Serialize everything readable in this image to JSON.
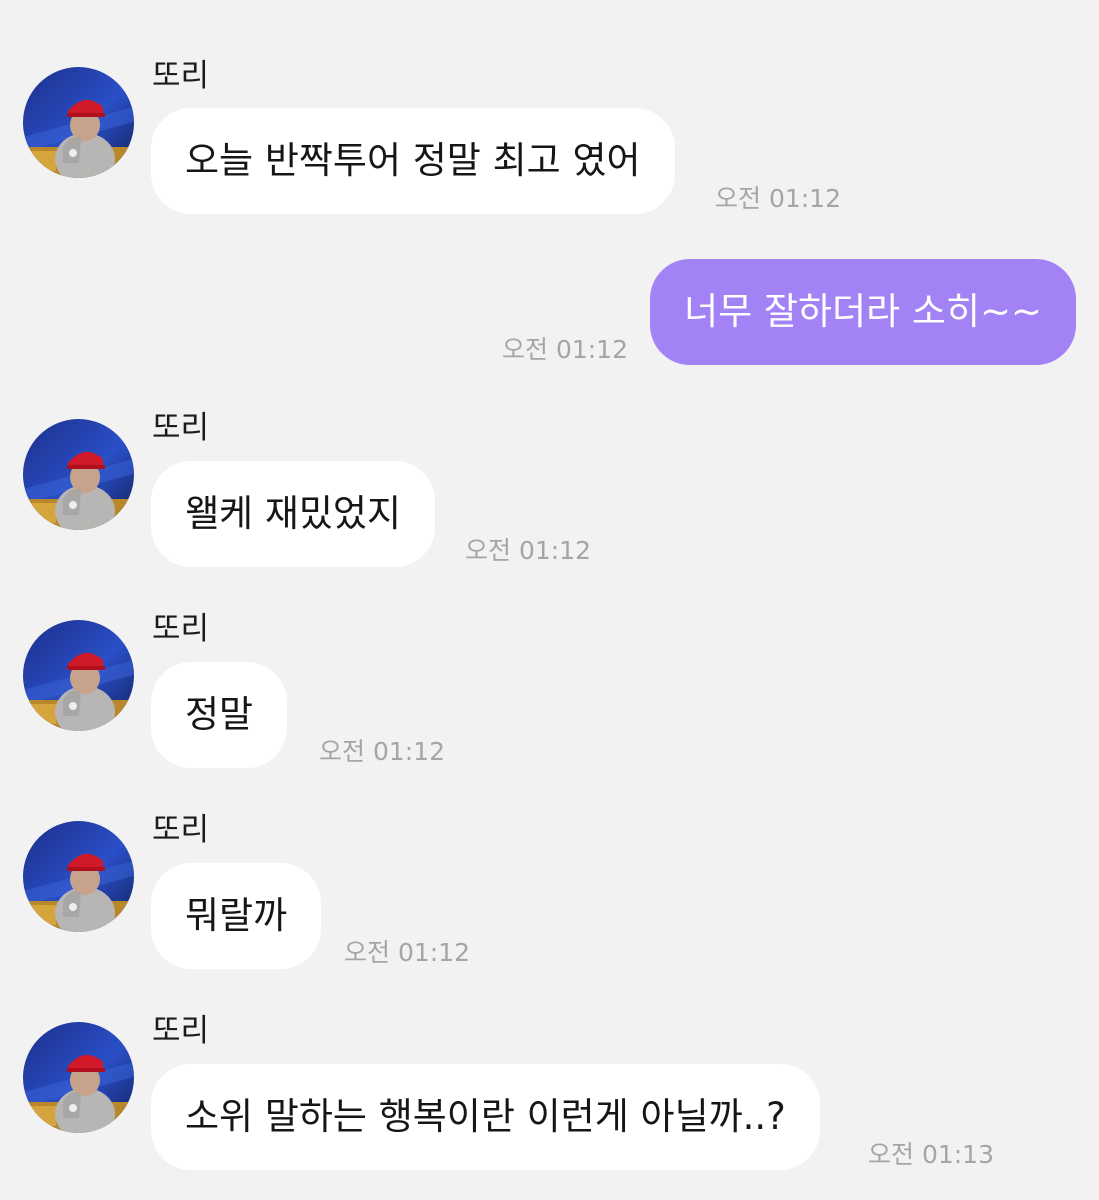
{
  "chat": {
    "messages": [
      {
        "sender": "또리",
        "text": "오늘 반짝투어 정말 최고 였어",
        "time": "오전 01:12",
        "direction": "incoming"
      },
      {
        "text": "너무 잘하더라 소히~~",
        "time": "오전 01:12",
        "direction": "outgoing"
      },
      {
        "sender": "또리",
        "text": "왤케 재밌었지",
        "time": "오전 01:12",
        "direction": "incoming"
      },
      {
        "sender": "또리",
        "text": "정말",
        "time": "오전 01:12",
        "direction": "incoming"
      },
      {
        "sender": "또리",
        "text": "뭐랄까",
        "time": "오전 01:12",
        "direction": "incoming"
      },
      {
        "sender": "또리",
        "text": "소위 말하는 행복이란 이런게 아닐까..?",
        "time": "오전 01:13",
        "direction": "incoming"
      }
    ]
  },
  "colors": {
    "background": "#f2f2f3",
    "incoming_bubble": "#ffffff",
    "outgoing_bubble": "#a282f5",
    "timestamp": "#a5a5a7"
  },
  "icons": {
    "avatar": "profile-photo"
  }
}
